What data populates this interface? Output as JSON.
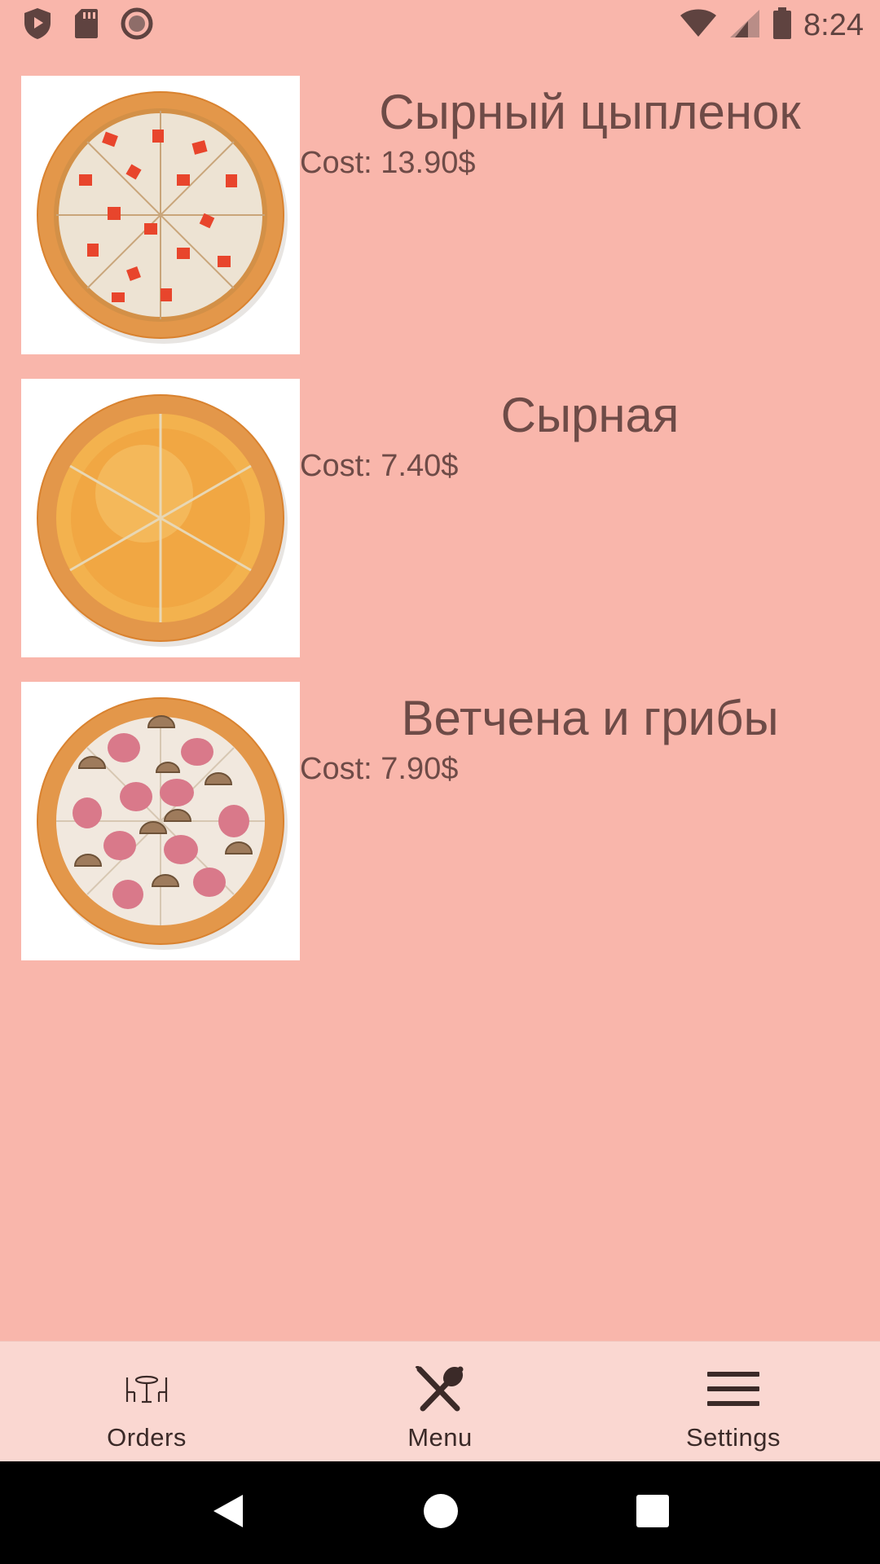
{
  "status_bar": {
    "time": "8:24",
    "left_icons": [
      "shield-play-icon",
      "sd-card-icon",
      "record-circle-icon"
    ],
    "right_icons": [
      "wifi-icon",
      "cell-signal-icon",
      "battery-icon"
    ]
  },
  "menu": {
    "items": [
      {
        "name": "Сырный цыпленок",
        "cost": "Cost: 13.90$",
        "topping": "tomato-chicken"
      },
      {
        "name": "Сырная",
        "cost": "Cost: 7.40$",
        "topping": "cheese"
      },
      {
        "name": "Ветчена и грибы",
        "cost": "Cost: 7.90$",
        "topping": "ham-mushroom"
      }
    ]
  },
  "bottom_nav": {
    "orders_label": "Orders",
    "menu_label": "Menu",
    "settings_label": "Settings",
    "selected": "Menu"
  },
  "system_nav": {
    "icons": [
      "back-icon",
      "home-icon",
      "recents-icon"
    ]
  },
  "colors": {
    "background": "#F9B6AB",
    "bottom_nav_bg": "#FAD7D1",
    "text": "#6E4B47"
  }
}
